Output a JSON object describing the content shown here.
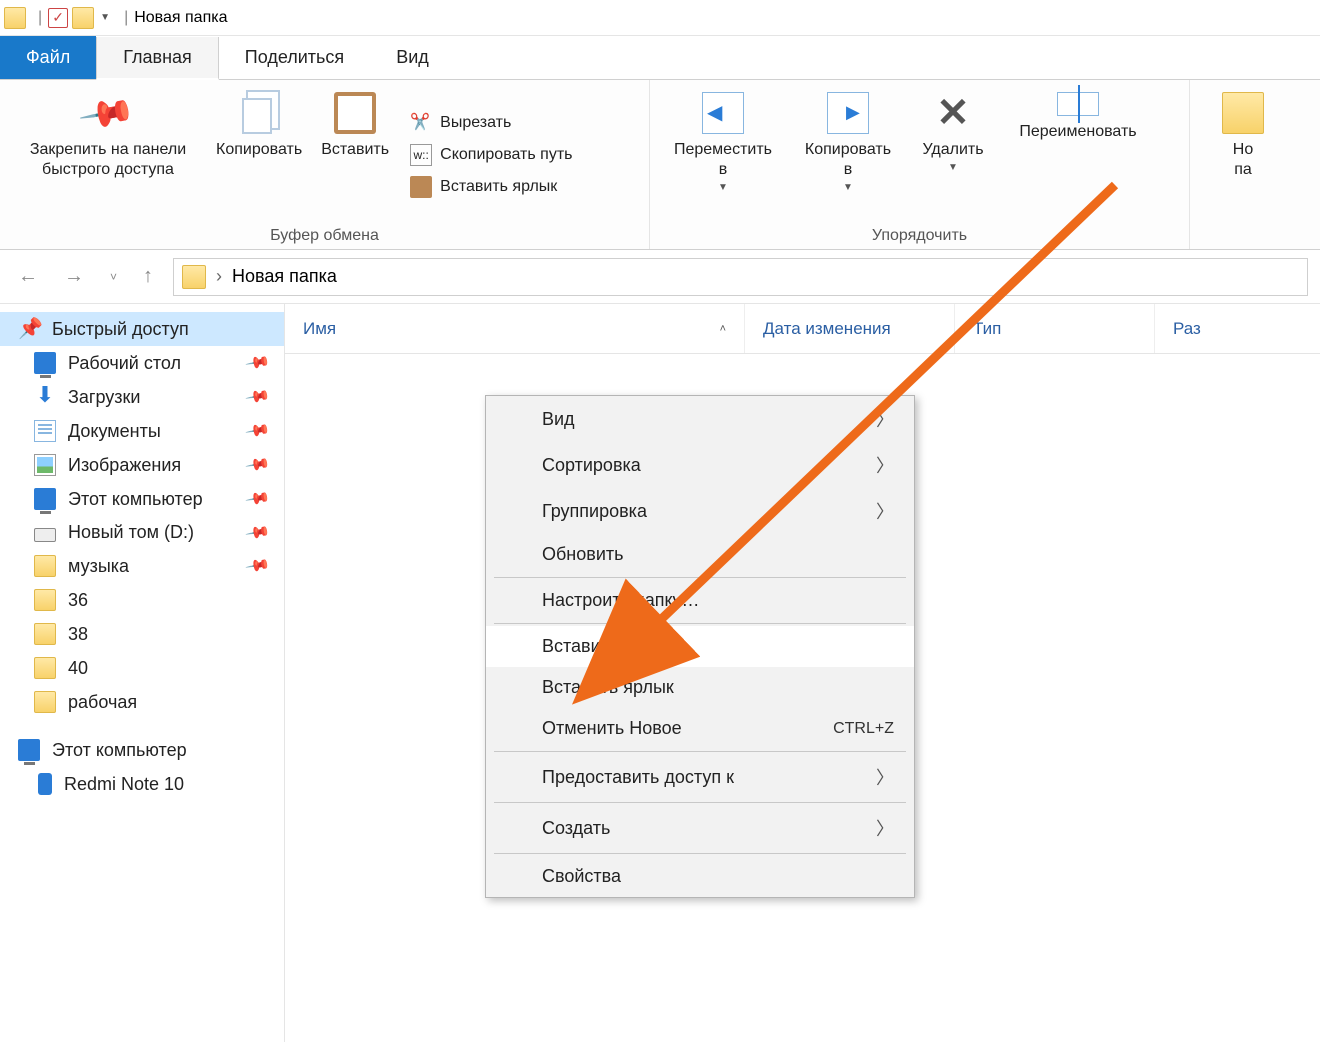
{
  "title_bar": {
    "window_title": "Новая папка"
  },
  "tabs": {
    "file": "Файл",
    "home": "Главная",
    "share": "Поделиться",
    "view": "Вид"
  },
  "ribbon": {
    "clipboard": {
      "pin": "Закрепить на панели\nбыстрого доступа",
      "copy": "Копировать",
      "paste": "Вставить",
      "cut": "Вырезать",
      "copy_path": "Скопировать путь",
      "paste_shortcut": "Вставить ярлык",
      "group_label": "Буфер обмена"
    },
    "organize": {
      "move": "Переместить\nв",
      "copy_to": "Копировать\nв",
      "delete": "Удалить",
      "rename": "Переименовать",
      "group_label": "Упорядочить"
    },
    "new_folder": "Но\nпа"
  },
  "address": {
    "breadcrumb": "Новая папка"
  },
  "columns": {
    "name": "Имя",
    "date": "Дата изменения",
    "type": "Тип",
    "size": "Раз"
  },
  "sidebar": {
    "quick": "Быстрый доступ",
    "items": [
      {
        "label": "Рабочий стол",
        "icon": "monitor",
        "pin": true
      },
      {
        "label": "Загрузки",
        "icon": "down",
        "pin": true
      },
      {
        "label": "Документы",
        "icon": "docs",
        "pin": true
      },
      {
        "label": "Изображения",
        "icon": "image",
        "pin": true
      },
      {
        "label": "Этот компьютер",
        "icon": "monitor",
        "pin": true
      },
      {
        "label": "Новый том (D:)",
        "icon": "disk",
        "pin": true
      },
      {
        "label": "музыка",
        "icon": "folder",
        "pin": true
      },
      {
        "label": "36",
        "icon": "folder",
        "pin": false
      },
      {
        "label": "38",
        "icon": "folder",
        "pin": false
      },
      {
        "label": "40",
        "icon": "folder",
        "pin": false
      },
      {
        "label": "рабочая",
        "icon": "folder",
        "pin": false
      }
    ],
    "this_pc": "Этот компьютер",
    "phone": "Redmi Note 10"
  },
  "context_menu": {
    "view": "Вид",
    "sort": "Сортировка",
    "group": "Группировка",
    "refresh": "Обновить",
    "customize": "Настроить папку…",
    "paste": "Вставить",
    "paste_shortcut": "Вставить ярлык",
    "undo": "Отменить Новое",
    "undo_key": "CTRL+Z",
    "share": "Предоставить доступ к",
    "create": "Создать",
    "properties": "Свойства"
  }
}
